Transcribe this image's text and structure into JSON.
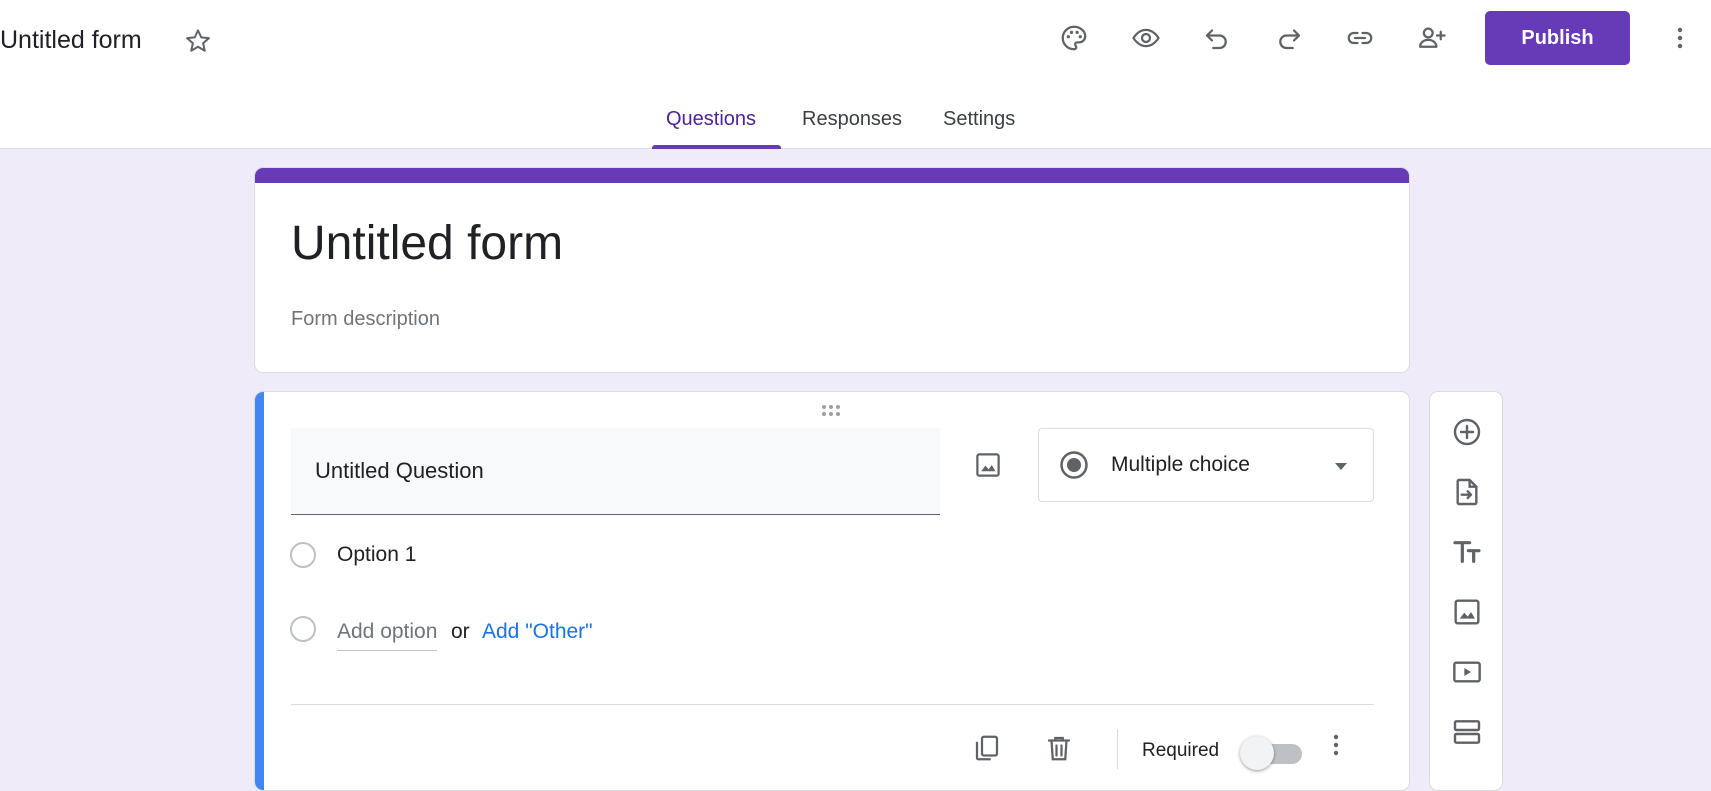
{
  "header": {
    "doc_title": "Untitled form",
    "publish_label": "Publish",
    "icons": [
      "star-icon",
      "palette-icon",
      "preview-icon",
      "undo-icon",
      "redo-icon",
      "link-icon",
      "add-collaborator-icon",
      "more-vert-icon"
    ]
  },
  "tabs": [
    {
      "label": "Questions",
      "active": true
    },
    {
      "label": "Responses",
      "active": false
    },
    {
      "label": "Settings",
      "active": false
    }
  ],
  "form": {
    "title": "Untitled form",
    "description_placeholder": "Form description"
  },
  "question": {
    "title": "Untitled Question",
    "type": "Multiple choice",
    "options": [
      "Option 1"
    ],
    "add_option": "Add option",
    "or_text": "or",
    "add_other": "Add \"Other\"",
    "required_label": "Required",
    "required_on": false
  },
  "side_toolbar": [
    "add-question-icon",
    "import-questions-icon",
    "add-title-icon",
    "add-image-icon",
    "add-video-icon",
    "add-section-icon"
  ],
  "colors": {
    "accent": "#673ab7",
    "background": "#f0ebf8",
    "active_question_bar": "#4285f4",
    "link": "#1a73e8"
  }
}
